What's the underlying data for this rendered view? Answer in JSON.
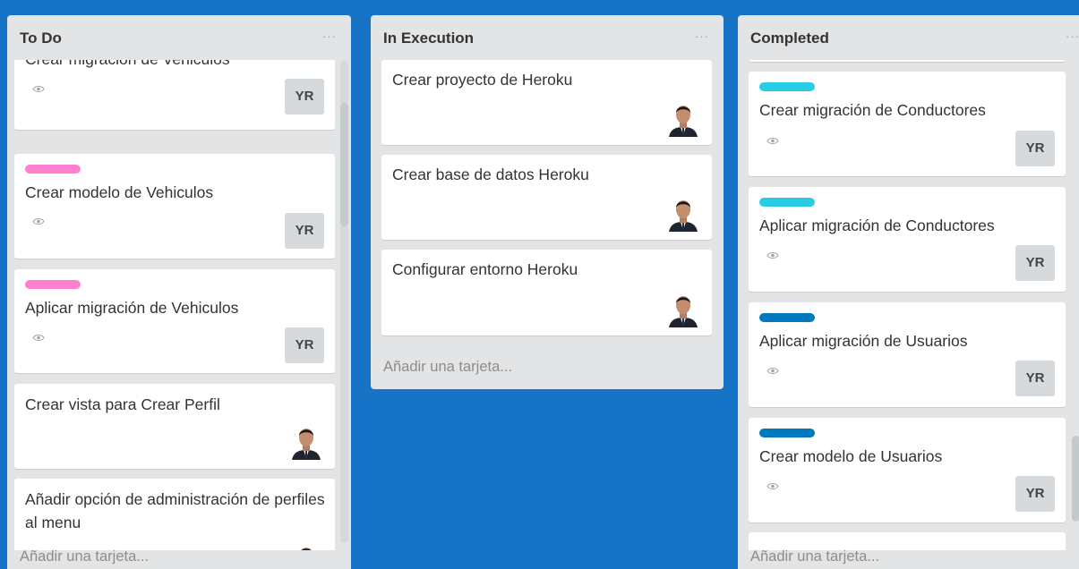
{
  "columns": [
    {
      "title": "To Do",
      "menu": "···",
      "add_card": "Añadir una tarjeta...",
      "cards": [
        {
          "title": "Crear migración de Vehiculos",
          "member": "YR",
          "label_color": "",
          "watch": true
        },
        {
          "title": "Crear modelo de Vehiculos",
          "member": "YR",
          "label_color": "#ff80ce",
          "watch": true
        },
        {
          "title": "Aplicar migración de Vehiculos",
          "member": "YR",
          "label_color": "#ff80ce",
          "watch": true
        },
        {
          "title": "Crear vista para Crear Perfil",
          "member": "",
          "label_color": "",
          "watch": false
        },
        {
          "title": "Añadir opción de administración de perfiles al menu",
          "member": "",
          "label_color": "",
          "watch": false
        }
      ]
    },
    {
      "title": "In Execution",
      "menu": "···",
      "add_card": "Añadir una tarjeta...",
      "cards": [
        {
          "title": "Crear proyecto de Heroku",
          "member": "",
          "label_color": "",
          "watch": false
        },
        {
          "title": "Crear base de datos Heroku",
          "member": "",
          "label_color": "",
          "watch": false
        },
        {
          "title": "Configurar entorno Heroku",
          "member": "",
          "label_color": "",
          "watch": false
        }
      ]
    },
    {
      "title": "Completed",
      "menu": "···",
      "add_card": "Añadir una tarjeta...",
      "cards": [
        {
          "title": "Crear migración de Conductores",
          "member": "YR",
          "label_color": "#29cce5",
          "watch": true
        },
        {
          "title": "Aplicar migración de Conductores",
          "member": "YR",
          "label_color": "#29cce5",
          "watch": true
        },
        {
          "title": "Aplicar migración de Usuarios",
          "member": "YR",
          "label_color": "#0079bf",
          "watch": true
        },
        {
          "title": "Crear modelo de Usuarios",
          "member": "YR",
          "label_color": "#0079bf",
          "watch": true
        }
      ]
    }
  ]
}
